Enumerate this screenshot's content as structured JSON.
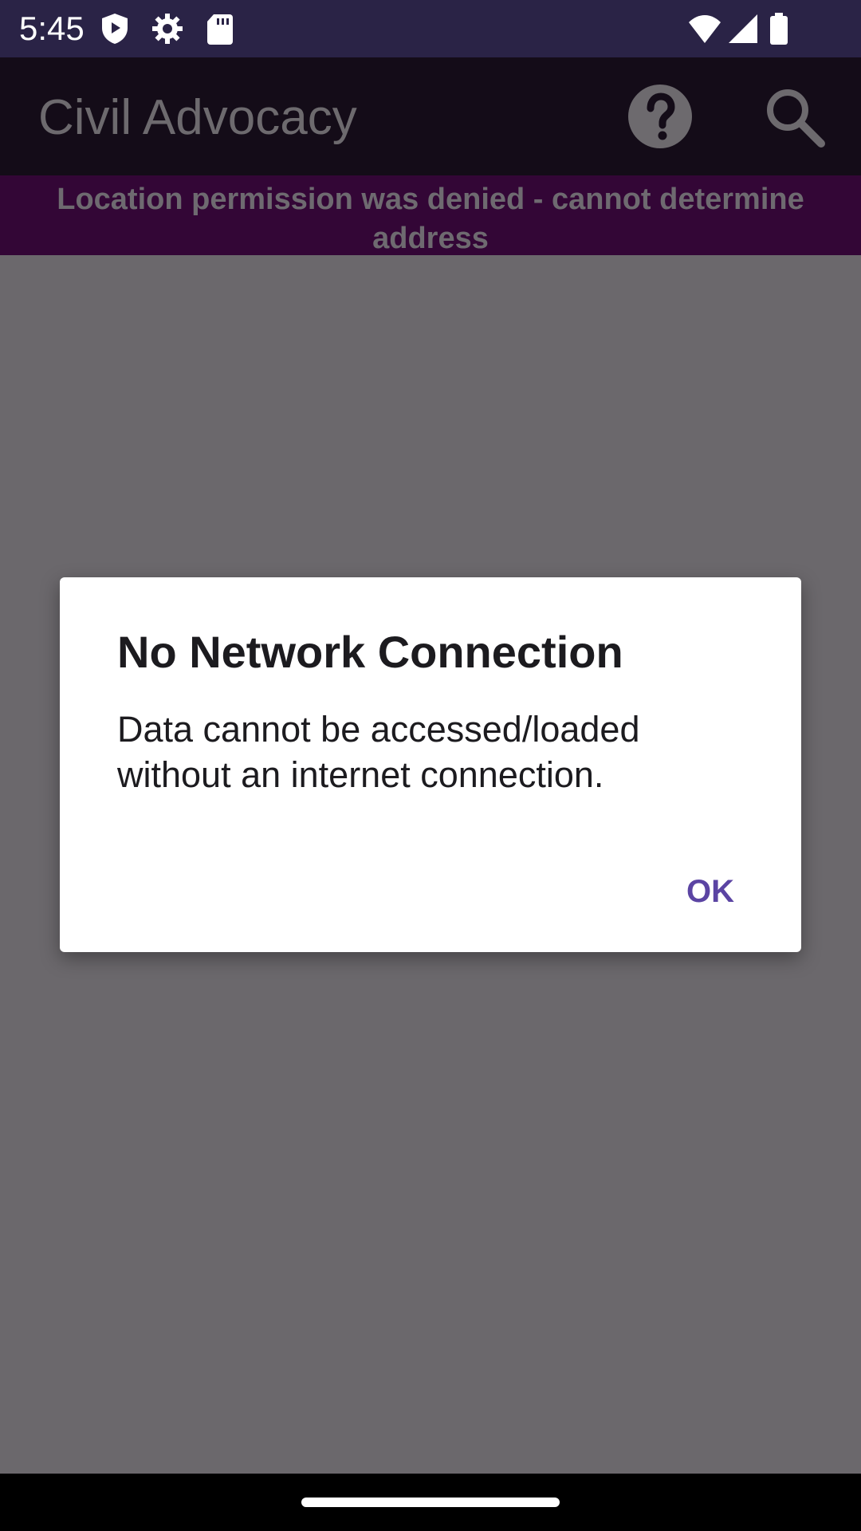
{
  "status_bar": {
    "time": "5:45",
    "icons": [
      "shield-play-icon",
      "gear-icon",
      "sd-card-icon",
      "wifi-icon",
      "cell-signal-icon",
      "battery-icon"
    ]
  },
  "app_bar": {
    "title": "Civil Advocacy",
    "actions": [
      "help-icon",
      "search-icon"
    ]
  },
  "banner": {
    "text": "Location permission was denied - cannot determine address"
  },
  "dialog": {
    "title": "No Network Connection",
    "message": "Data cannot be accessed/loaded without an internet connection.",
    "ok_label": "OK"
  },
  "colors": {
    "status_bar_bg": "#2a2346",
    "app_bar_bg": "#140c18",
    "banner_bg": "#330636",
    "scrim": "#6b686c",
    "dialog_bg": "#ffffff",
    "accent": "#5b44a3"
  }
}
